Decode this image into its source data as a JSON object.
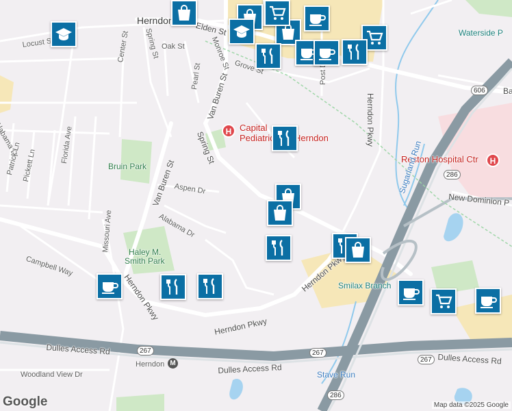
{
  "map": {
    "attribution": "Map data ©2025 Google",
    "logo": "Google",
    "colors": {
      "background": "#f2eff2",
      "park": "#cfe8c6",
      "commercial": "#f6e7b8",
      "hospital_area": "#f8dde0",
      "water": "#a6d3f0",
      "road": "#ffffff",
      "highway": "#8a9aa3",
      "pin": "#0b6fa4"
    },
    "places": [
      {
        "id": "herndon",
        "label": "Herndon"
      },
      {
        "id": "bruin-park",
        "label": "Bruin Park"
      },
      {
        "id": "haley-smith-park-1",
        "label": "Haley M."
      },
      {
        "id": "haley-smith-park-2",
        "label": "Smith Park"
      },
      {
        "id": "capital-peds-1",
        "label": "Capital"
      },
      {
        "id": "capital-peds-2",
        "label": "Pediatric"
      },
      {
        "id": "capital-peds-3",
        "label": "Herndon"
      },
      {
        "id": "reston-hospital",
        "label": "Reston Hospital Ctr"
      },
      {
        "id": "waterside",
        "label": "Waterside P"
      },
      {
        "id": "smilax",
        "label": "Smilax Branch"
      },
      {
        "id": "stave-run",
        "label": "Stave Run"
      },
      {
        "id": "sugarland-run",
        "label": "Sugarland Run"
      }
    ],
    "streets": [
      {
        "id": "elden",
        "label": "Elden St"
      },
      {
        "id": "locust",
        "label": "Locust St"
      },
      {
        "id": "center",
        "label": "Center St"
      },
      {
        "id": "spring-north",
        "label": "Spring St"
      },
      {
        "id": "oak",
        "label": "Oak St"
      },
      {
        "id": "monroe",
        "label": "Monroe St"
      },
      {
        "id": "grove",
        "label": "Grove St"
      },
      {
        "id": "post",
        "label": "Post Dr"
      },
      {
        "id": "van-buren-north",
        "label": "Van Buren St"
      },
      {
        "id": "pearl",
        "label": "Pearl St"
      },
      {
        "id": "herndon-pkwy-east",
        "label": "Herndon Pkwy"
      },
      {
        "id": "florida",
        "label": "Florida Ave"
      },
      {
        "id": "alabama-dr-west",
        "label": "Alabama Dr"
      },
      {
        "id": "patrick",
        "label": "Patrick Ln"
      },
      {
        "id": "pickett",
        "label": "Pickett Ln"
      },
      {
        "id": "spring-south",
        "label": "Spring St"
      },
      {
        "id": "van-buren-south",
        "label": "Van Buren St"
      },
      {
        "id": "aspen",
        "label": "Aspen Dr"
      },
      {
        "id": "alabama",
        "label": "Alabama Dr"
      },
      {
        "id": "missouri",
        "label": "Missouri Ave"
      },
      {
        "id": "campbell",
        "label": "Campbell Way"
      },
      {
        "id": "herndon-pkwy-mid",
        "label": "Herndon Pkwy"
      },
      {
        "id": "herndon-pkwy-south",
        "label": "Herndon Pkwy"
      },
      {
        "id": "herndon-pkwy-west",
        "label": "Herndon Pkwy"
      },
      {
        "id": "new-dominion",
        "label": "New Dominion P"
      },
      {
        "id": "dulles-west",
        "label": "Dulles Access Rd"
      },
      {
        "id": "dulles-mid",
        "label": "Dulles Access Rd"
      },
      {
        "id": "dulles-east",
        "label": "Dulles Access Rd"
      },
      {
        "id": "herndon-metro",
        "label": "Herndon"
      },
      {
        "id": "woodland",
        "label": "Woodland View Dr"
      },
      {
        "id": "ba",
        "label": "Ba"
      }
    ],
    "shields": [
      "606",
      "286",
      "267",
      "267",
      "267",
      "286"
    ],
    "hospital_marker": "H",
    "metro_marker": "M",
    "pins": [
      {
        "type": "cart",
        "icon": "shopping-cart-icon"
      },
      {
        "type": "coffee",
        "icon": "coffee-cup-icon"
      },
      {
        "type": "bag",
        "icon": "shopping-bag-icon"
      },
      {
        "type": "school",
        "icon": "graduation-cap-icon"
      },
      {
        "type": "school",
        "icon": "graduation-cap-icon"
      },
      {
        "type": "bag",
        "icon": "shopping-bag-icon"
      },
      {
        "type": "coffee",
        "icon": "coffee-cup-icon"
      },
      {
        "type": "cart",
        "icon": "shopping-cart-icon"
      },
      {
        "type": "food",
        "icon": "fork-knife-icon"
      },
      {
        "type": "coffee",
        "icon": "coffee-cup-icon"
      },
      {
        "type": "food",
        "icon": "fork-knife-icon"
      },
      {
        "type": "food",
        "icon": "fork-knife-icon"
      },
      {
        "type": "bag",
        "icon": "shopping-bag-icon"
      },
      {
        "type": "bag",
        "icon": "shopping-bag-icon"
      },
      {
        "type": "food",
        "icon": "fork-knife-icon"
      },
      {
        "type": "food",
        "icon": "fork-knife-icon"
      },
      {
        "type": "bag",
        "icon": "shopping-bag-icon"
      },
      {
        "type": "coffee",
        "icon": "coffee-cup-icon"
      },
      {
        "type": "food",
        "icon": "fork-knife-icon"
      },
      {
        "type": "food",
        "icon": "fork-knife-icon"
      },
      {
        "type": "coffee",
        "icon": "coffee-cup-icon"
      },
      {
        "type": "cart",
        "icon": "shopping-cart-icon"
      },
      {
        "type": "coffee",
        "icon": "coffee-cup-icon"
      },
      {
        "type": "cart",
        "icon": "shopping-cart-icon"
      },
      {
        "type": "bag",
        "icon": "shopping-bag-icon"
      }
    ]
  }
}
